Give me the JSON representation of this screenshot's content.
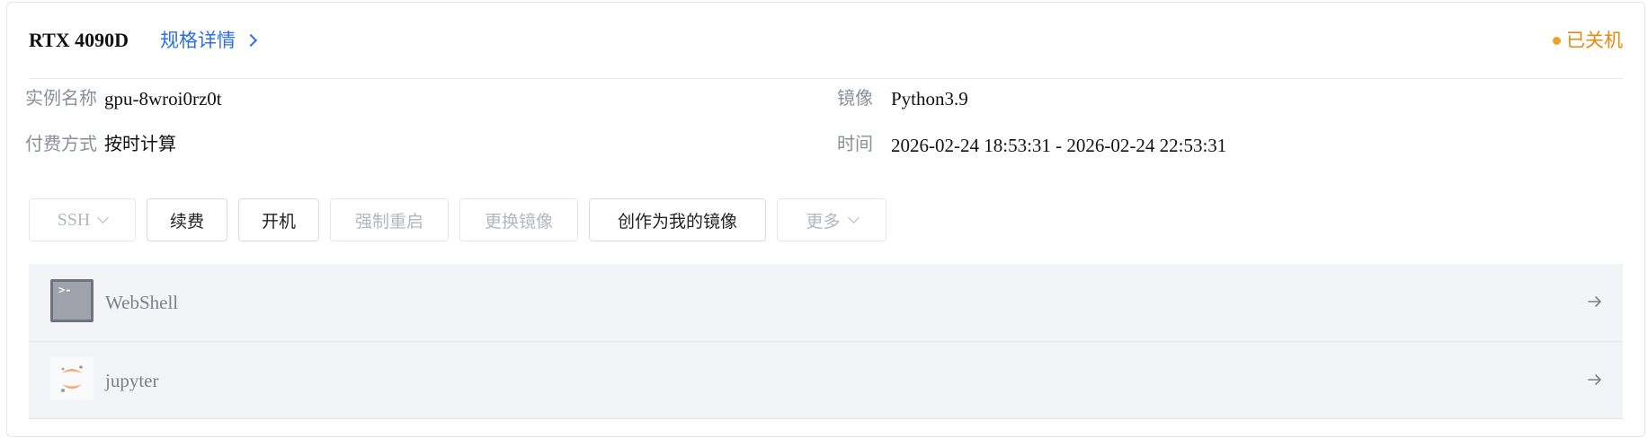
{
  "header": {
    "gpu_name": "RTX 4090D",
    "spec_link": "规格详情",
    "status": "已关机",
    "status_color": "#e58a0e"
  },
  "info": {
    "instance_name_label": "实例名称",
    "instance_name_value": "gpu-8wroi0rz0t",
    "image_label": "镜像",
    "image_value": "Python3.9",
    "billing_label": "付费方式",
    "billing_value": "按时计算",
    "time_label": "时间",
    "time_value": "2026-02-24 18:53:31 - 2026-02-24 22:53:31"
  },
  "actions": {
    "ssh": "SSH",
    "renew": "续费",
    "power_on": "开机",
    "force_restart": "强制重启",
    "change_image": "更换镜像",
    "create_image": "创作为我的镜像",
    "more": "更多"
  },
  "tools": [
    {
      "name": "WebShell",
      "icon": "terminal-icon"
    },
    {
      "name": "jupyter",
      "icon": "jupyter-icon"
    }
  ],
  "colors": {
    "accent": "#2f6fe0",
    "status": "#e58a0e",
    "tools_bg": "#f3f4f7"
  }
}
